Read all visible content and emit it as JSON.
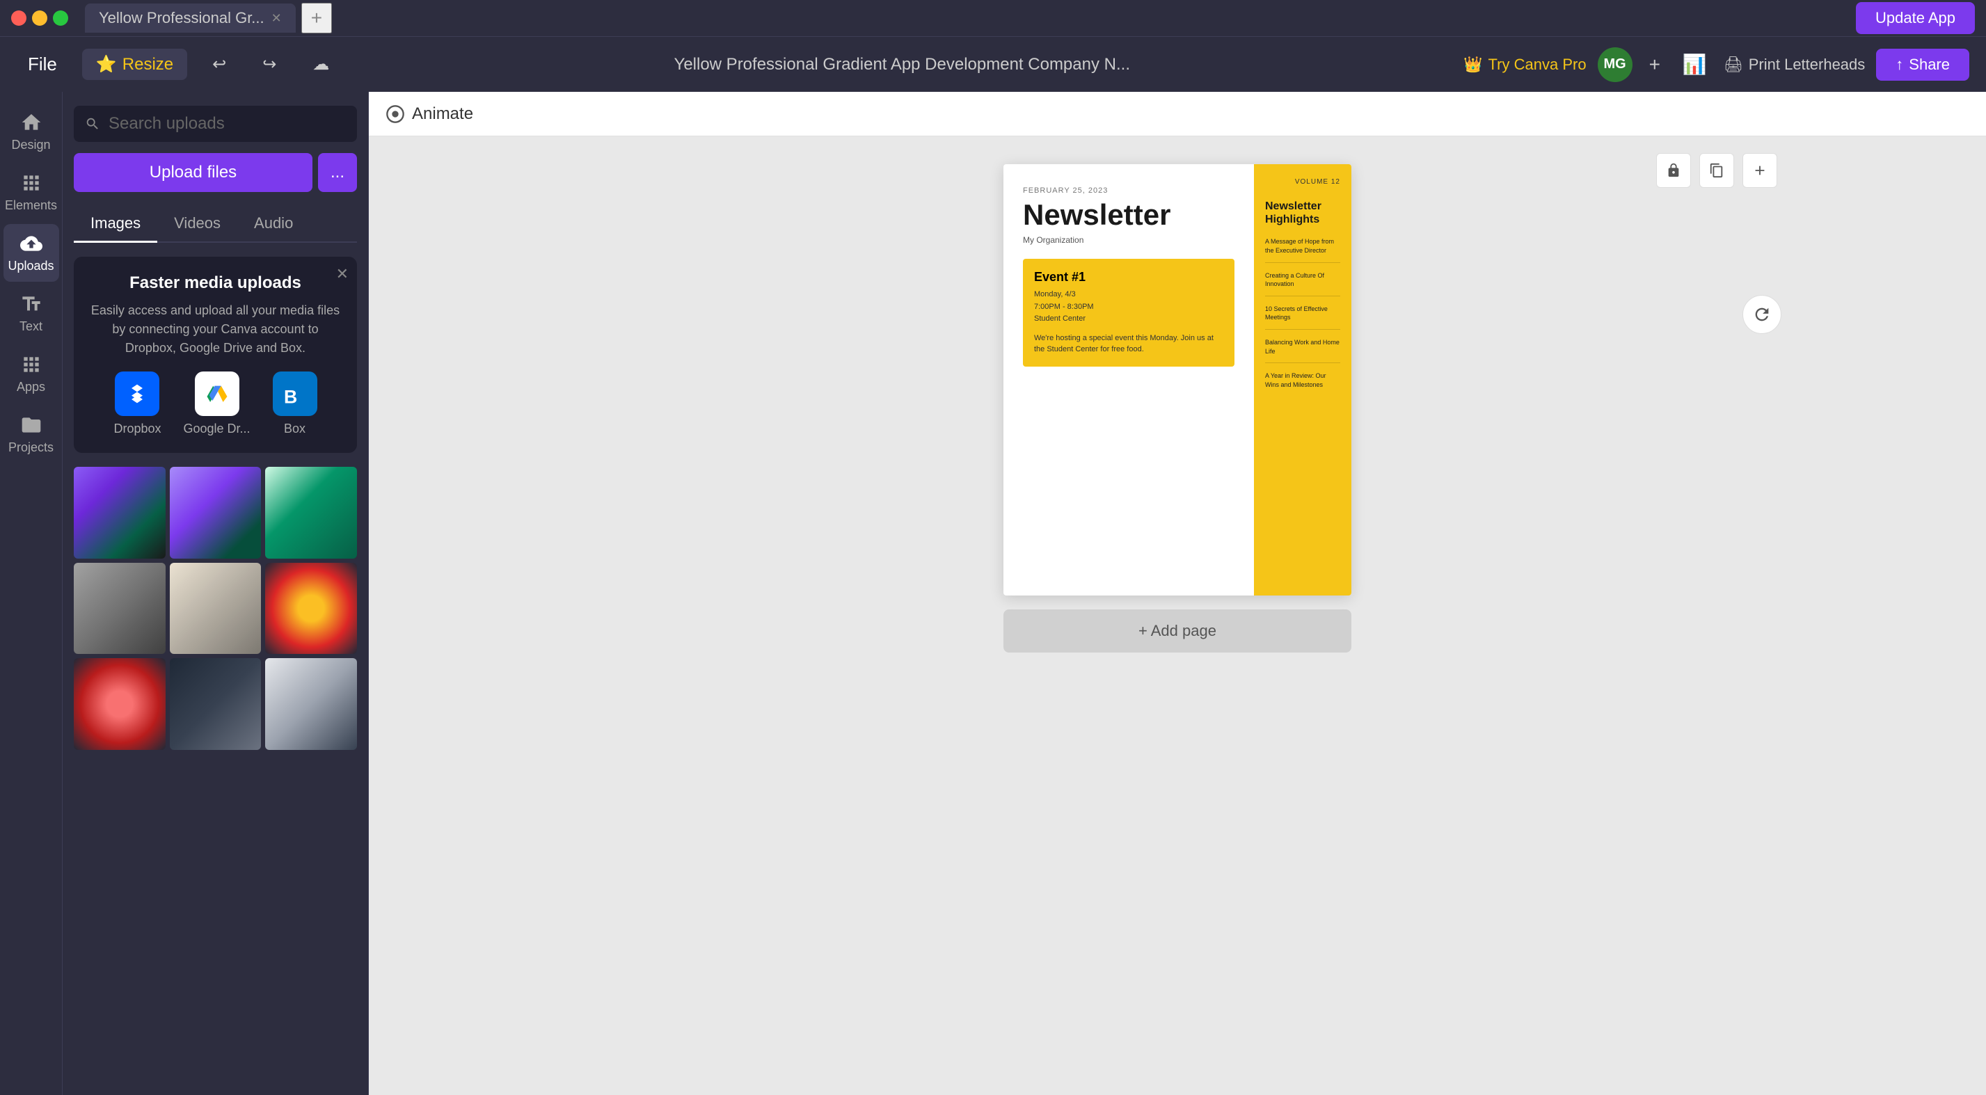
{
  "titlebar": {
    "tab_label": "Yellow Professional Gr...",
    "update_app_label": "Update App"
  },
  "toolbar": {
    "file_label": "File",
    "resize_label": "Resize",
    "document_title": "Yellow Professional Gradient App Development Company N...",
    "try_canva_pro_label": "Try Canva Pro",
    "avatar_initials": "MG",
    "print_label": "Print Letterheads",
    "share_label": "Share"
  },
  "left_nav": {
    "items": [
      {
        "id": "design",
        "label": "Design",
        "icon": "home"
      },
      {
        "id": "elements",
        "label": "Elements",
        "icon": "elements"
      },
      {
        "id": "uploads",
        "label": "Uploads",
        "icon": "uploads"
      },
      {
        "id": "text",
        "label": "Text",
        "icon": "text"
      },
      {
        "id": "apps",
        "label": "Apps",
        "icon": "apps"
      },
      {
        "id": "projects",
        "label": "Projects",
        "icon": "projects"
      }
    ]
  },
  "uploads_panel": {
    "search_placeholder": "Search uploads",
    "upload_btn_label": "Upload files",
    "more_btn_label": "...",
    "tabs": [
      {
        "id": "images",
        "label": "Images",
        "active": true
      },
      {
        "id": "videos",
        "label": "Videos",
        "active": false
      },
      {
        "id": "audio",
        "label": "Audio",
        "active": false
      }
    ],
    "media_popup": {
      "title": "Faster media uploads",
      "description": "Easily access and upload all your media files by connecting your Canva account to Dropbox, Google Drive and Box.",
      "services": [
        {
          "id": "dropbox",
          "label": "Dropbox"
        },
        {
          "id": "googledrive",
          "label": "Google Dr..."
        },
        {
          "id": "box",
          "label": "Box"
        }
      ]
    }
  },
  "animate_bar": {
    "label": "Animate"
  },
  "newsletter": {
    "date": "FEBRUARY 25, 2023",
    "title": "Newsletter",
    "org": "My Organization",
    "volume": "VOLUME 12",
    "event_title": "Event #1",
    "event_day": "Monday, 4/3",
    "event_time": "7:00PM - 8:30PM",
    "event_location": "Student Center",
    "event_desc": "We're hosting a special event this Monday. Join us at the Student Center for free food.",
    "highlights_title": "Newsletter Highlights",
    "highlights": [
      "A Message of Hope from the Executive Director",
      "Creating a Culture Of Innovation",
      "10 Secrets of Effective Meetings",
      "Balancing Work and Home Life",
      "A Year in Review: Our Wins and Milestones"
    ]
  },
  "add_page_label": "+ Add page"
}
